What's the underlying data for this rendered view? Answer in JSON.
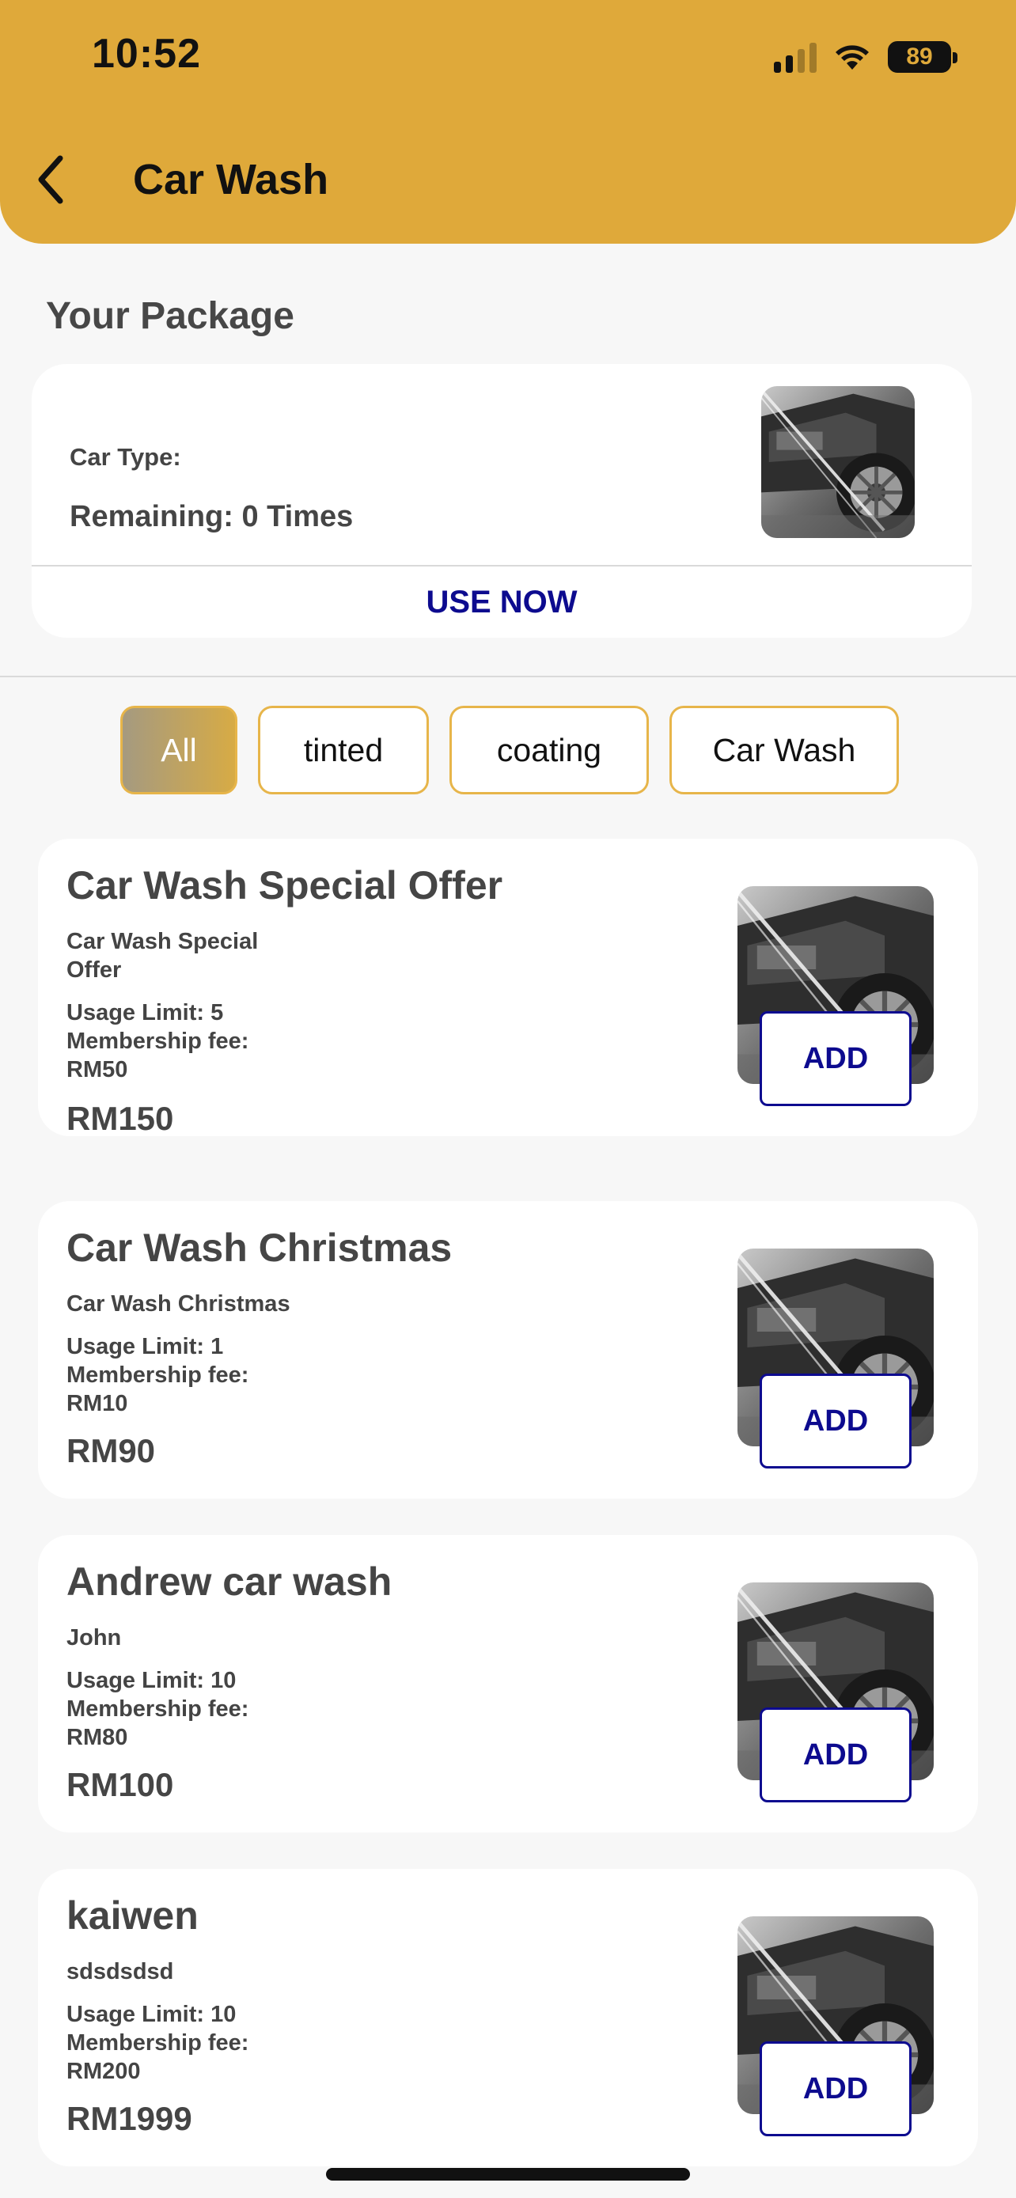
{
  "status_bar": {
    "time": "10:52",
    "battery": "89"
  },
  "header": {
    "title": "Car Wash"
  },
  "package": {
    "section_title": "Your Package",
    "car_type_label": "Car Type:",
    "remaining": "Remaining: 0 Times",
    "use_now": "USE NOW"
  },
  "filters": [
    "All",
    "tinted",
    "coating",
    "Car Wash"
  ],
  "products": [
    {
      "title": "Car Wash Special Offer",
      "desc": "Car Wash Special Offer",
      "limit": "Usage Limit: 5",
      "fee": "Membership fee: RM50",
      "price": "RM150",
      "add": "ADD"
    },
    {
      "title": "Car Wash Christmas",
      "desc": "Car Wash Christmas",
      "limit": "Usage Limit: 1",
      "fee": "Membership fee: RM10",
      "price": "RM90",
      "add": "ADD"
    },
    {
      "title": "Andrew car wash",
      "desc": "John",
      "limit": "Usage Limit: 10",
      "fee": "Membership fee: RM80",
      "price": "RM100",
      "add": "ADD"
    },
    {
      "title": "kaiwen",
      "desc": "sdsdsdsd",
      "limit": "Usage Limit: 10",
      "fee": "Membership fee: RM200",
      "price": "RM1999",
      "add": "ADD"
    }
  ],
  "icons": {
    "back": "chevron-left-icon",
    "signal": "cellular-signal-icon",
    "wifi": "wifi-icon",
    "battery": "battery-icon"
  },
  "colors": {
    "header": "#dfa93a",
    "accent_navy": "#0d0b8f",
    "chip_border": "#e7b54a"
  }
}
